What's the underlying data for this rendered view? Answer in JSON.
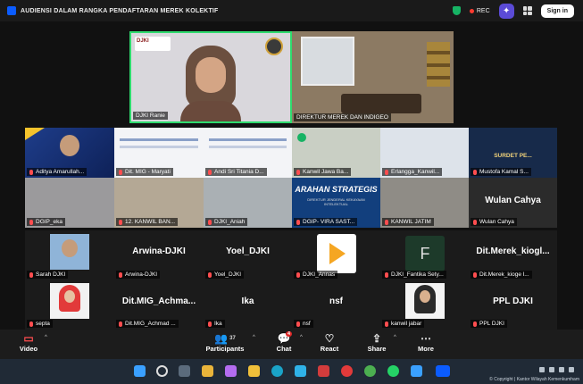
{
  "header": {
    "title": "AUDIENSI DALAM RANGKA PENDAFTARAN MEREK KOLEKTIF",
    "rec_label": "REC",
    "signin_label": "Sign in"
  },
  "speakers": [
    {
      "name": "DJKI Ranie",
      "logo_text": "DJKI"
    },
    {
      "name": "DIREKTUR MEREK DAN INDIGEO"
    }
  ],
  "strip_row1": [
    "Aditya Amarullah...",
    "Dit. MIG - Maryati",
    "Andi Sri Titania D...",
    "Kanwil Jawa Ba...",
    "Erlangga_Kanwil...",
    "Mustofa Kamal S..."
  ],
  "strip_row2": [
    "DGIP_eka",
    "12. KANWIL BAN...",
    "DJKI_Aniah",
    "DGIP- VIRA SAST...",
    "KANWIL JATIM",
    "Wulan Cahya"
  ],
  "slide": {
    "title": "ARAHAN STRATEGIS",
    "subtitle": "DIREKTUR JENDERAL KEKAYAAN INTELEKTUAL",
    "surdet": "SURDET PE..."
  },
  "big_row1": [
    {
      "display": "",
      "label": "Sarah DJKI"
    },
    {
      "display": "Arwina-DJKI",
      "label": "Arwina-DJKI"
    },
    {
      "display": "Yoel_DJKI",
      "label": "Yoel_DJKI"
    },
    {
      "display": "",
      "label": "DJKI_Annas"
    },
    {
      "display": "F",
      "label": "DJKI_Fantika Sety..."
    },
    {
      "display": "Dit.Merek_kiogl...",
      "label": "Dit.Merek_kioge l..."
    }
  ],
  "big_row2": [
    {
      "display": "",
      "label": "septa"
    },
    {
      "display": "Dit.MIG_Achma...",
      "label": "Dit.MIG_Achmad ..."
    },
    {
      "display": "Ika",
      "label": "Ika"
    },
    {
      "display": "nsf",
      "label": "nsf"
    },
    {
      "display": "",
      "label": "kanwil jabar"
    },
    {
      "display": "PPL DJKI",
      "label": "PPL DJKI"
    }
  ],
  "wulan_big": "Wulan Cahya",
  "toolbar": {
    "video": "Video",
    "participants": "Participants",
    "participants_count": "37",
    "chat": "Chat",
    "chat_badge": "4",
    "react": "React",
    "share": "Share",
    "more": "More"
  },
  "taskbar": {
    "copyright": "© Copyright | Kantor Wilayah Kemenkumham"
  },
  "colors": {
    "active_speaker": "#2fdb6e",
    "rec_dot": "#ff3b30",
    "mic_muted": "#ff4d4f"
  }
}
